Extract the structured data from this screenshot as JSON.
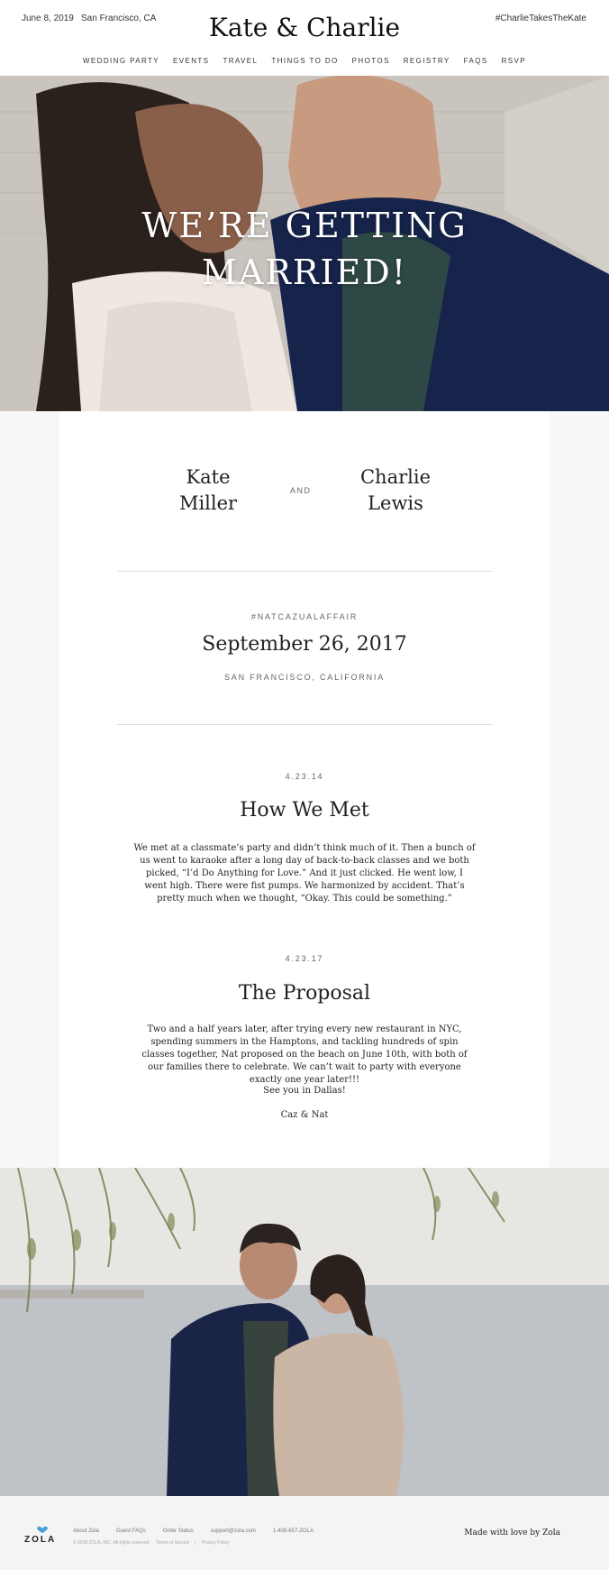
{
  "header": {
    "date": "June 8, 2019",
    "location": "San Francisco, CA",
    "title": "Kate & Charlie",
    "hashtag": "#CharlieTakesTheKate"
  },
  "nav": [
    "WEDDING PARTY",
    "EVENTS",
    "TRAVEL",
    "THINGS TO DO",
    "PHOTOS",
    "REGISTRY",
    "FAQS",
    "RSVP"
  ],
  "hero": {
    "line1": "WE’RE GETTING",
    "line2": "MARRIED!"
  },
  "couple": {
    "left_first": "Kate",
    "left_last": "Miller",
    "and": "AND",
    "right_first": "Charlie",
    "right_last": "Lewis"
  },
  "event": {
    "hashtag": "#NATCAZUALAFFAIR",
    "date": "September 26, 2017",
    "location": "SAN FRANCISCO, CALIFORNIA"
  },
  "story": [
    {
      "date": "4.23.14",
      "title": "How We Met",
      "text": "We met at a classmate’s party and didn’t think much of it. Then a bunch of us went to karaoke after a long day of back-to-back classes and we both picked, “I’d Do Anything for Love.” And it just clicked. He went low, I went high. There were fist pumps. We harmonized by accident. That’s pretty much when we thought, “Okay. This could be something.”"
    },
    {
      "date": "4.23.17",
      "title": "The Proposal",
      "text": "Two and a half years later, after trying every new restaurant in NYC, spending summers in the Hamptons, and tackling hundreds of spin classes together, Nat proposed on the beach on June 10th, with both of our families there to celebrate. We can’t wait to party with everyone exactly one year later!!!",
      "line2": "See you in Dallas!",
      "signature": "Caz & Nat"
    }
  ],
  "footer": {
    "brand": "ZOLA",
    "links": [
      "About Zola",
      "Guest FAQs",
      "Order Status",
      "support@zola.com",
      "1-408-657-ZOLA"
    ],
    "copyright": "© 2018 ZOLA, INC.  All rights reserved.",
    "terms": "Terms of Service",
    "separator": "|",
    "privacy": "Privacy Policy",
    "made_by": "Made with love by Zola"
  },
  "colors": {
    "accent_blue": "#4a9fd8",
    "text_dark": "#222222",
    "footer_bg": "#f4f4f4"
  }
}
